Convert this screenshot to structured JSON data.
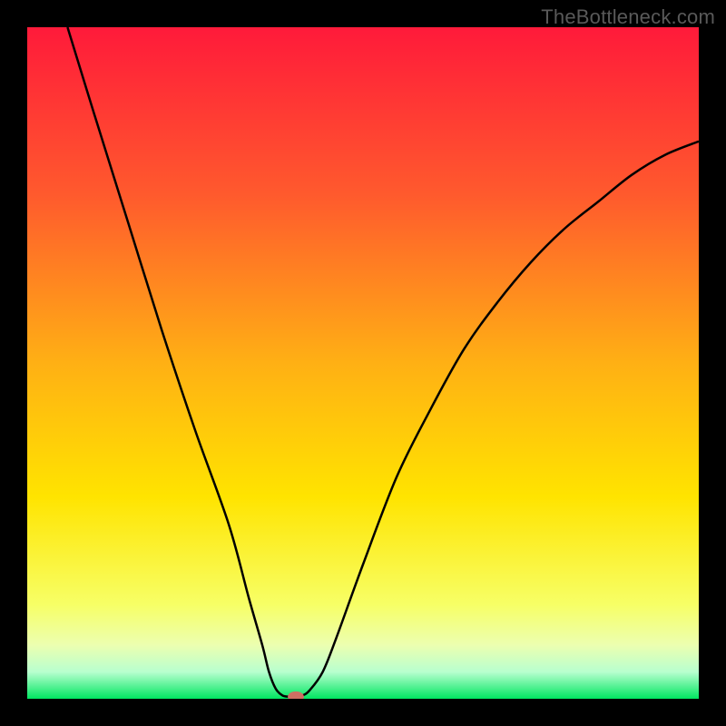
{
  "watermark": "TheBottleneck.com",
  "chart_data": {
    "type": "line",
    "title": "",
    "xlabel": "",
    "ylabel": "",
    "xlim": [
      0,
      100
    ],
    "ylim": [
      0,
      100
    ],
    "grid": false,
    "legend": false,
    "background_gradient": {
      "stops": [
        {
          "offset": 0.0,
          "color": "#ff1a3a"
        },
        {
          "offset": 0.25,
          "color": "#ff5a2d"
        },
        {
          "offset": 0.5,
          "color": "#ffb014"
        },
        {
          "offset": 0.7,
          "color": "#ffe400"
        },
        {
          "offset": 0.86,
          "color": "#f7ff66"
        },
        {
          "offset": 0.92,
          "color": "#ecffb0"
        },
        {
          "offset": 0.96,
          "color": "#b8ffcf"
        },
        {
          "offset": 1.0,
          "color": "#00e661"
        }
      ]
    },
    "series": [
      {
        "name": "bottleneck-curve",
        "color": "#000000",
        "width": 2.5,
        "points": [
          {
            "x": 6,
            "y": 100
          },
          {
            "x": 10,
            "y": 87
          },
          {
            "x": 15,
            "y": 71
          },
          {
            "x": 20,
            "y": 55
          },
          {
            "x": 25,
            "y": 40
          },
          {
            "x": 30,
            "y": 26
          },
          {
            "x": 33,
            "y": 15
          },
          {
            "x": 35,
            "y": 8
          },
          {
            "x": 36,
            "y": 4
          },
          {
            "x": 37,
            "y": 1.5
          },
          {
            "x": 38,
            "y": 0.5
          },
          {
            "x": 39,
            "y": 0.3
          },
          {
            "x": 40,
            "y": 0.3
          },
          {
            "x": 41,
            "y": 0.5
          },
          {
            "x": 42,
            "y": 1.2
          },
          {
            "x": 44,
            "y": 4
          },
          {
            "x": 46,
            "y": 9
          },
          {
            "x": 50,
            "y": 20
          },
          {
            "x": 55,
            "y": 33
          },
          {
            "x": 60,
            "y": 43
          },
          {
            "x": 65,
            "y": 52
          },
          {
            "x": 70,
            "y": 59
          },
          {
            "x": 75,
            "y": 65
          },
          {
            "x": 80,
            "y": 70
          },
          {
            "x": 85,
            "y": 74
          },
          {
            "x": 90,
            "y": 78
          },
          {
            "x": 95,
            "y": 81
          },
          {
            "x": 100,
            "y": 83
          }
        ]
      }
    ],
    "marker": {
      "name": "optimal-point",
      "x": 40,
      "y": 0.3,
      "width_pct": 2.4,
      "height_pct": 1.6,
      "color": "#cf6f63"
    }
  }
}
